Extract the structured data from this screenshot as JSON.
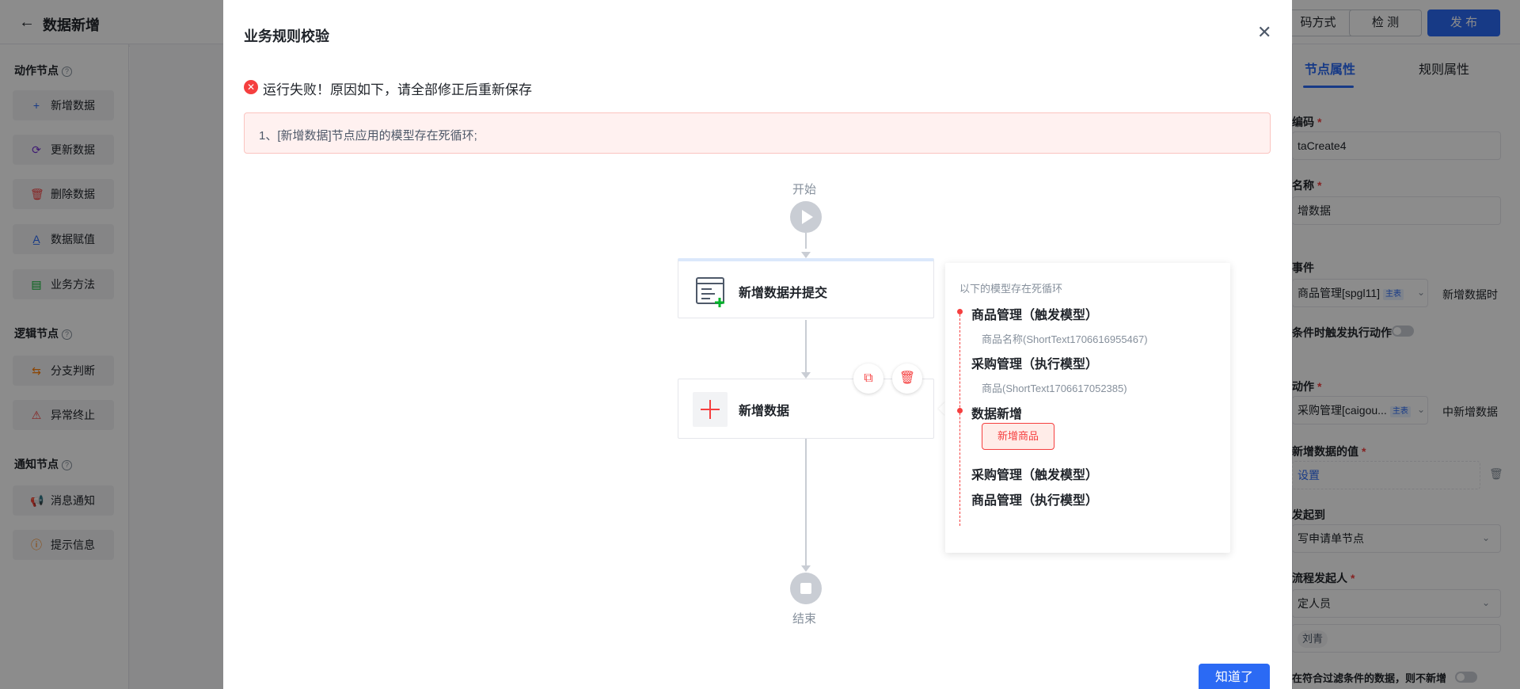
{
  "app": {
    "title": "数据新增",
    "back_icon": "arrow-left-icon",
    "buttons": {
      "code_mode": "码方式",
      "check": "检 测",
      "publish": "发 布"
    }
  },
  "sidebar": {
    "groups": [
      {
        "title": "动作节点",
        "items": [
          {
            "label": "新增数据",
            "icon": "plus-icon"
          },
          {
            "label": "更新数据",
            "icon": "refresh-icon"
          },
          {
            "label": "删除数据",
            "icon": "trash-icon"
          },
          {
            "label": "数据赋值",
            "icon": "assign-icon"
          },
          {
            "label": "业务方法",
            "icon": "table-icon"
          }
        ]
      },
      {
        "title": "逻辑节点",
        "items": [
          {
            "label": "分支判断",
            "icon": "branch-icon"
          },
          {
            "label": "异常终止",
            "icon": "warning-icon"
          }
        ]
      },
      {
        "title": "通知节点",
        "items": [
          {
            "label": "消息通知",
            "icon": "megaphone-icon"
          },
          {
            "label": "提示信息",
            "icon": "info-icon"
          }
        ]
      }
    ]
  },
  "right_panel": {
    "tabs": [
      "节点属性",
      "规则属性"
    ],
    "fields": {
      "code_label": "编码",
      "code_value": "taCreate4",
      "name_label": "名称",
      "name_value": "增数据",
      "event_label": "事件",
      "event_model": "商品管理[spgl11]",
      "event_tag": "主表",
      "event_suffix": "新增数据时",
      "condition_trigger": "条件时触发执行动作",
      "action_label": "动作",
      "action_model": "采购管理[caigou...",
      "action_tag": "主表",
      "action_suffix": "中新增数据",
      "new_value_label": "新增数据的值",
      "new_value_link": "设置",
      "initiate_label": "发起到",
      "initiate_value": "写申请单节点",
      "initiator_label": "流程发起人",
      "initiator_value": "定人员",
      "person_chip": "刘青",
      "filter_text": "在符合过滤条件的数据，则不新增"
    }
  },
  "modal": {
    "title": "业务规则校验",
    "close_icon": "close-icon",
    "error_message": "运行失败！原因如下，请全部修正后重新保存",
    "error_detail": "1、[新增数据]节点应用的模型存在死循环;",
    "confirm_label": "知道了"
  },
  "flow": {
    "start_label": "开始",
    "end_label": "结束",
    "node1_title": "新增数据并提交",
    "node2_title": "新增数据",
    "node2_actions": [
      "copy-icon",
      "trash-icon"
    ]
  },
  "loop_card": {
    "header": "以下的模型存在死循环",
    "items": [
      {
        "title": "商品管理（触发模型）",
        "sub": "商品名称(ShortText1706616955467)"
      },
      {
        "title": "采购管理（执行模型）",
        "sub": "商品(ShortText1706617052385)"
      },
      {
        "title": "数据新增",
        "tag": "新增商品"
      },
      {
        "title": "采购管理（触发模型）"
      },
      {
        "title": "商品管理（执行模型）"
      }
    ]
  },
  "colors": {
    "primary": "#2b6af4",
    "error": "#f53f3f",
    "error_bg": "#fff1f0"
  }
}
